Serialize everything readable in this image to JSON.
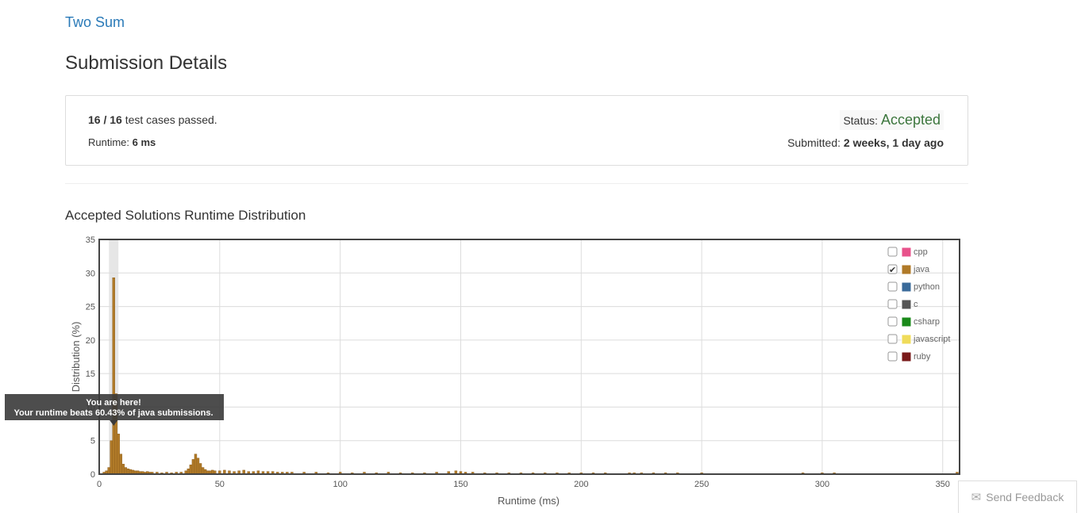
{
  "problem": {
    "title": "Two Sum"
  },
  "page_title": "Submission Details",
  "summary": {
    "passed": "16",
    "total": "16",
    "passed_text": "test cases passed.",
    "runtime_label": "Runtime:",
    "runtime_value": "6 ms",
    "status_label": "Status:",
    "status_value": "Accepted",
    "submitted_label": "Submitted:",
    "submitted_value": "2 weeks, 1 day ago"
  },
  "distribution_title": "Accepted Solutions Runtime Distribution",
  "tooltip": {
    "line1": "You are here!",
    "line2": "Your runtime beats 60.43% of java submissions."
  },
  "feedback": {
    "label": "Send Feedback",
    "icon": "envelope-icon"
  },
  "chart_data": {
    "type": "bar",
    "xlabel": "Runtime (ms)",
    "ylabel": "Distribution (%)",
    "xlim": [
      0,
      357
    ],
    "ylim": [
      0,
      35
    ],
    "xticks": [
      0,
      50,
      100,
      150,
      200,
      250,
      300,
      350
    ],
    "yticks": [
      0,
      5,
      10,
      15,
      20,
      25,
      30,
      35
    ],
    "highlight_x": 6,
    "legend": [
      {
        "name": "cpp",
        "color": "#e8528b",
        "checked": false
      },
      {
        "name": "java",
        "color": "#b07a28",
        "checked": true
      },
      {
        "name": "python",
        "color": "#3a6a9a",
        "checked": false
      },
      {
        "name": "c",
        "color": "#555555",
        "checked": false
      },
      {
        "name": "csharp",
        "color": "#1a8a1a",
        "checked": false
      },
      {
        "name": "javascript",
        "color": "#f0dc5a",
        "checked": false
      },
      {
        "name": "ruby",
        "color": "#7a1a1a",
        "checked": false
      }
    ],
    "series": [
      {
        "name": "java",
        "color": "#b07a28",
        "x": [
          2,
          3,
          4,
          5,
          6,
          7,
          8,
          9,
          10,
          11,
          12,
          13,
          14,
          15,
          16,
          17,
          18,
          19,
          20,
          21,
          22,
          24,
          26,
          28,
          30,
          32,
          34,
          36,
          37,
          38,
          39,
          40,
          41,
          42,
          43,
          44,
          45,
          46,
          47,
          48,
          50,
          52,
          54,
          56,
          58,
          60,
          62,
          64,
          66,
          68,
          70,
          72,
          74,
          76,
          78,
          80,
          85,
          90,
          95,
          100,
          105,
          110,
          115,
          120,
          125,
          130,
          135,
          140,
          145,
          148,
          150,
          152,
          155,
          160,
          165,
          170,
          175,
          180,
          185,
          190,
          195,
          200,
          205,
          210,
          220,
          222,
          225,
          230,
          235,
          240,
          250,
          292,
          300,
          305,
          356
        ],
        "values": [
          0.3,
          0.5,
          1.0,
          5.0,
          29.3,
          12.0,
          6.0,
          3.0,
          1.5,
          1.0,
          0.8,
          0.7,
          0.6,
          0.5,
          0.5,
          0.4,
          0.4,
          0.3,
          0.4,
          0.3,
          0.3,
          0.3,
          0.2,
          0.3,
          0.2,
          0.3,
          0.3,
          0.5,
          0.8,
          1.4,
          2.2,
          3.0,
          2.4,
          1.6,
          1.0,
          0.7,
          0.5,
          0.5,
          0.6,
          0.5,
          0.5,
          0.6,
          0.5,
          0.4,
          0.5,
          0.6,
          0.4,
          0.4,
          0.5,
          0.4,
          0.4,
          0.4,
          0.3,
          0.3,
          0.3,
          0.3,
          0.3,
          0.3,
          0.2,
          0.3,
          0.2,
          0.3,
          0.2,
          0.3,
          0.2,
          0.2,
          0.2,
          0.3,
          0.4,
          0.5,
          0.4,
          0.3,
          0.3,
          0.2,
          0.2,
          0.2,
          0.2,
          0.2,
          0.2,
          0.2,
          0.2,
          0.2,
          0.2,
          0.2,
          0.2,
          0.2,
          0.2,
          0.2,
          0.2,
          0.2,
          0.2,
          0.2,
          0.2,
          0.2,
          0.3
        ]
      }
    ]
  }
}
